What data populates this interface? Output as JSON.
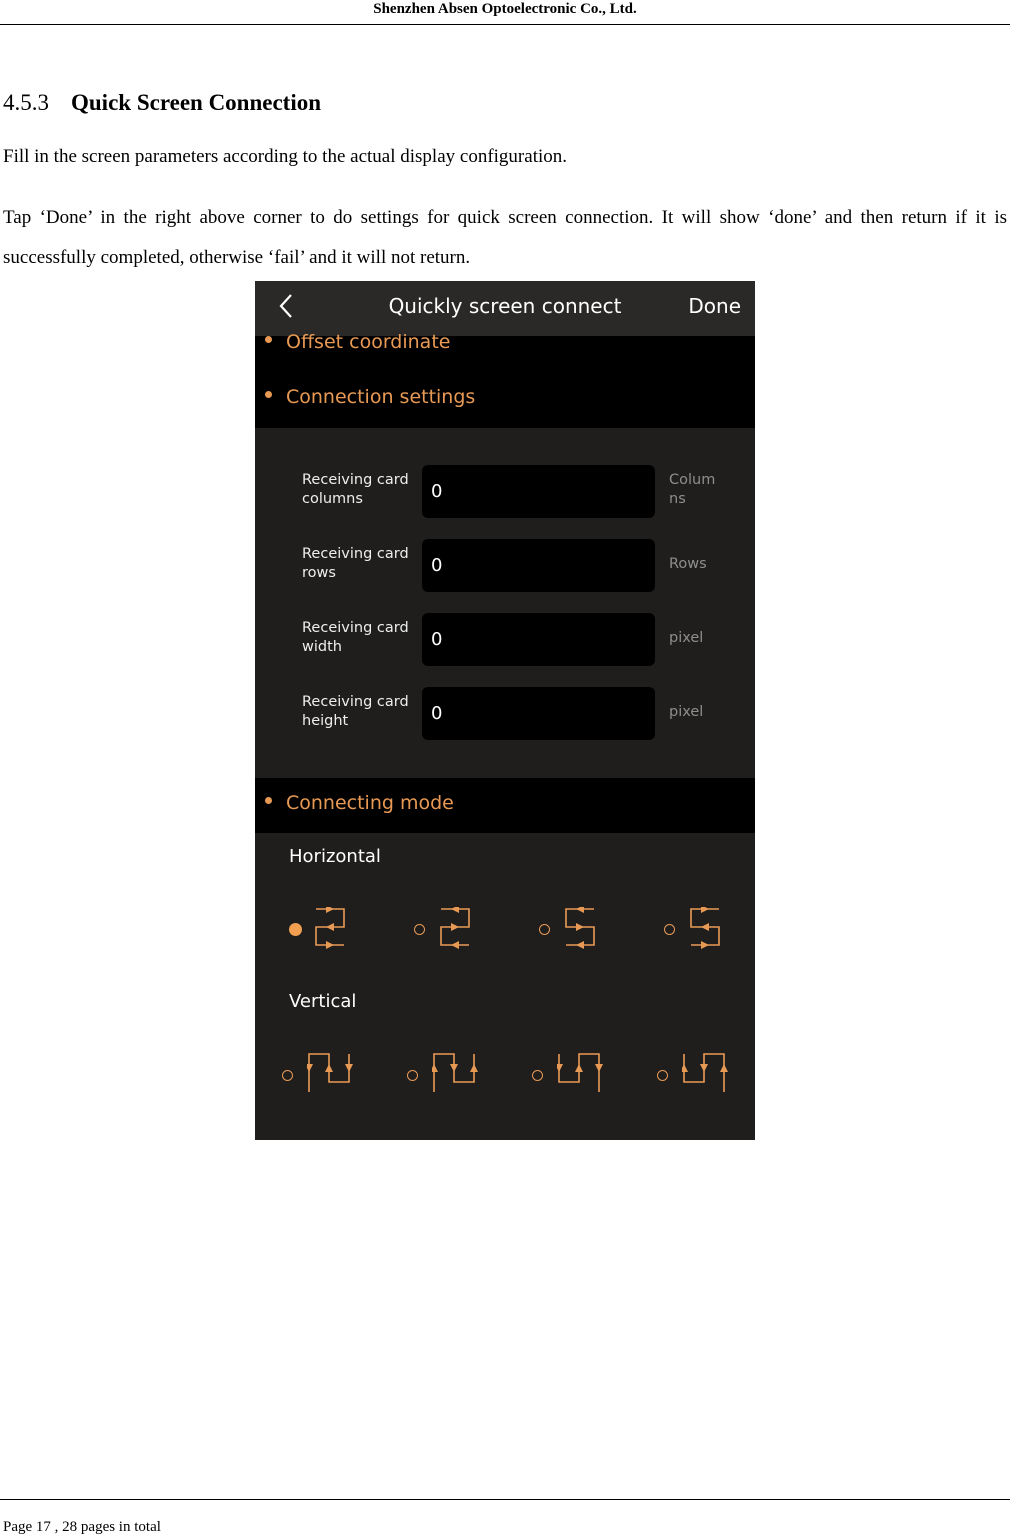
{
  "page_header": "Shenzhen Absen Optoelectronic Co., Ltd.",
  "section": {
    "number": "4.5.3",
    "title": "Quick Screen Connection"
  },
  "paragraphs": [
    "Fill in the screen parameters according to the actual display configuration.",
    "Tap ‘Done’ in the right above corner to do settings for quick screen connection. It will show ‘done’ and then return if it is successfully completed, otherwise ‘fail’ and it will not return."
  ],
  "app": {
    "nav": {
      "back_icon": "chevron-left-icon",
      "title": "Quickly screen connect",
      "done_label": "Done"
    },
    "sections": {
      "offset": "Offset coordinate",
      "connection": "Connection settings",
      "mode": "Connecting mode"
    },
    "fields": [
      {
        "label": "Receiving card columns",
        "value": "0",
        "unit": "Columns"
      },
      {
        "label": "Receiving card rows",
        "value": "0",
        "unit": "Rows"
      },
      {
        "label": "Receiving card width",
        "value": "0",
        "unit": "pixel"
      },
      {
        "label": "Receiving card height",
        "value": "0",
        "unit": "pixel"
      }
    ],
    "mode_groups": {
      "horizontal": {
        "label": "Horizontal",
        "selected_index": 0,
        "options": 4
      },
      "vertical": {
        "label": "Vertical",
        "selected_index": null,
        "options": 4
      }
    },
    "colors": {
      "accent": "#e89a55",
      "background": "#1f1e1d",
      "band": "#000000",
      "nav": "#2a2928"
    }
  },
  "footer": "Page 17 , 28 pages in total"
}
